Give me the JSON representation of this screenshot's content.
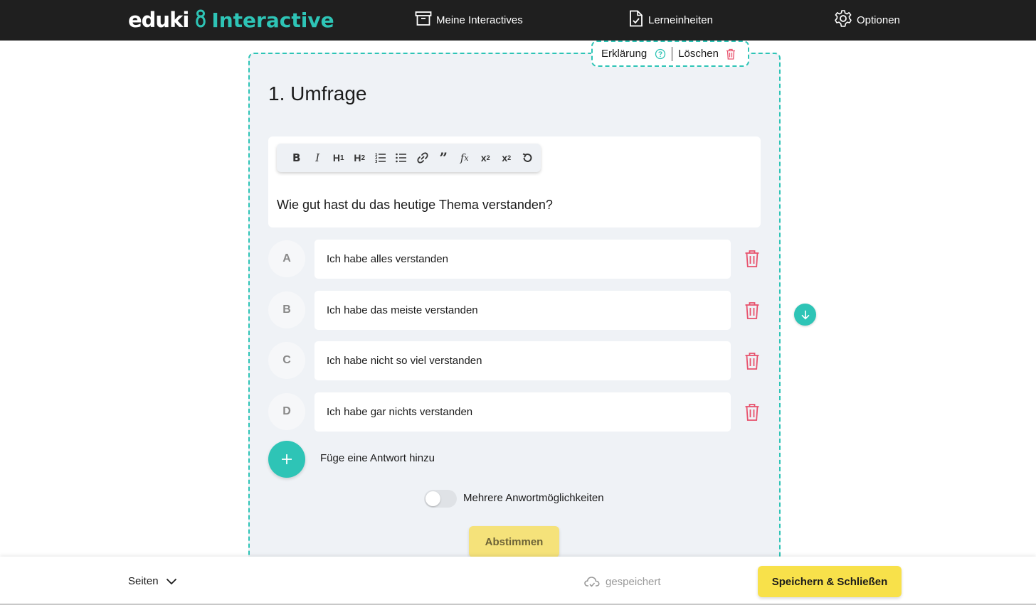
{
  "header": {
    "logo_primary": "eduki",
    "logo_secondary": "Interactive",
    "nav": [
      {
        "label": "Meine Interactives",
        "icon": "archive-icon"
      },
      {
        "label": "Lerneinheiten",
        "icon": "document-check-icon"
      },
      {
        "label": "Optionen",
        "icon": "gear-icon"
      }
    ]
  },
  "card": {
    "actions": {
      "explain_label": "Erklärung",
      "delete_label": "Löschen"
    },
    "title": "1. Umfrage",
    "toolbar": [
      "B",
      "I",
      "H₁",
      "H₂",
      "ordered-list",
      "bullet-list",
      "link",
      "quote",
      "formula",
      "X₂",
      "X²",
      "undo"
    ],
    "question": "Wie gut hast du das heutige Thema verstanden?",
    "answers": [
      {
        "letter": "A",
        "text": "Ich habe alles verstanden"
      },
      {
        "letter": "B",
        "text": "Ich habe das meiste verstanden"
      },
      {
        "letter": "C",
        "text": "Ich habe nicht so viel verstanden"
      },
      {
        "letter": "D",
        "text": "Ich habe gar nichts verstanden"
      }
    ],
    "add_answer_label": "Füge eine Antwort hinzu",
    "multi_toggle_label": "Mehrere Anwortmöglichkeiten",
    "multi_toggle_on": false,
    "vote_label": "Abstimmen"
  },
  "footer": {
    "pages_label": "Seiten",
    "saved_label": "gespeichert",
    "save_close_label": "Speichern & Schließen"
  },
  "colors": {
    "accent": "#2ec4b6",
    "header_bg": "#1f1f1f",
    "delete": "#e8516c",
    "primary_button": "#f8e14a"
  }
}
